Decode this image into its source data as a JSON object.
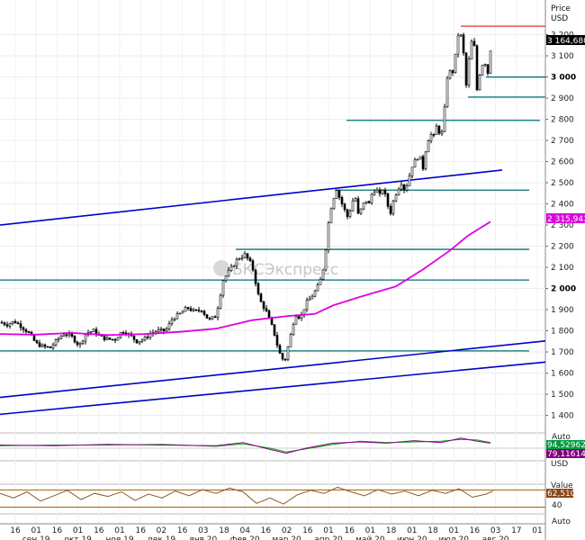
{
  "header": {
    "price_label": "Price",
    "currency_label": "USD"
  },
  "watermark": {
    "text": "БКСЭкспресс"
  },
  "last_price_tag": "3 164,6800",
  "ma_tag": "2 315,9438",
  "indicator1": {
    "scale_label": "Auto",
    "value_a": "94,529623",
    "value_b": "79,116144",
    "unit": "USD"
  },
  "indicator2": {
    "scale_label": "Value",
    "value": "62,510",
    "tick_40": "40",
    "auto_label": "Auto"
  },
  "x_ticks": [
    "16",
    "01",
    "16",
    "01",
    "16",
    "01",
    "16",
    "02",
    "16",
    "03",
    "18",
    "04",
    "16",
    "02",
    "16",
    "01",
    "16",
    "01",
    "18",
    "01",
    "18",
    "01",
    "16",
    "03",
    "17",
    "01"
  ],
  "x_month_labels": [
    "сен 19",
    "окт 19",
    "ноя 19",
    "дек 19",
    "янв 20",
    "фев 20",
    "мар 20",
    "апр 20",
    "май 20",
    "июн 20",
    "июл 20",
    "авг 20"
  ],
  "colors": {
    "candle": "#000000",
    "ma": "#e000e0",
    "channel": "#0000c8",
    "level": "#007070",
    "resistance": "#e03030",
    "macd_a": "#8b008b",
    "macd_b": "#00a000",
    "osc": "#8b5a2b",
    "osc_band": "#a06000",
    "tag_black": "#000000",
    "tag_ma": "#e000e0",
    "tag_green": "#009a3c",
    "tag_purple": "#800080",
    "tag_brown": "#8b4513"
  },
  "chart_data": {
    "type": "candlestick",
    "yunit": "USD",
    "ylim": [
      1330,
      3330
    ],
    "y_ticks": [
      1400,
      1500,
      1600,
      1700,
      1800,
      1900,
      2000,
      2100,
      2200,
      2300,
      2400,
      2500,
      2600,
      2700,
      2800,
      2900,
      3000,
      3100,
      3200
    ],
    "y_tick_labels": [
      "1 400",
      "1 500",
      "1 600",
      "1 700",
      "1 800",
      "1 900",
      "2 000",
      "2 100",
      "2 200",
      "2 300",
      "2 400",
      "2 500",
      "2 600",
      "2 700",
      "2 800",
      "2 900",
      "3 000",
      "3 100",
      "3 200"
    ],
    "close_path": [
      [
        0,
        1840
      ],
      [
        8,
        1830
      ],
      [
        16,
        1845
      ],
      [
        24,
        1820
      ],
      [
        32,
        1790
      ],
      [
        40,
        1740
      ],
      [
        48,
        1725
      ],
      [
        56,
        1720
      ],
      [
        64,
        1760
      ],
      [
        72,
        1790
      ],
      [
        80,
        1770
      ],
      [
        88,
        1730
      ],
      [
        96,
        1790
      ],
      [
        104,
        1800
      ],
      [
        112,
        1770
      ],
      [
        120,
        1760
      ],
      [
        128,
        1760
      ],
      [
        136,
        1800
      ],
      [
        144,
        1780
      ],
      [
        152,
        1750
      ],
      [
        160,
        1760
      ],
      [
        168,
        1790
      ],
      [
        176,
        1800
      ],
      [
        184,
        1800
      ],
      [
        192,
        1860
      ],
      [
        200,
        1880
      ],
      [
        208,
        1910
      ],
      [
        216,
        1890
      ],
      [
        224,
        1900
      ],
      [
        232,
        1850
      ],
      [
        240,
        1870
      ],
      [
        248,
        2040
      ],
      [
        256,
        2090
      ],
      [
        264,
        2140
      ],
      [
        272,
        2160
      ],
      [
        280,
        2110
      ],
      [
        288,
        1950
      ],
      [
        296,
        1890
      ],
      [
        304,
        1800
      ],
      [
        310,
        1700
      ],
      [
        316,
        1650
      ],
      [
        322,
        1760
      ],
      [
        328,
        1880
      ],
      [
        334,
        1860
      ],
      [
        340,
        1930
      ],
      [
        346,
        1960
      ],
      [
        352,
        2000
      ],
      [
        358,
        2060
      ],
      [
        362,
        2190
      ],
      [
        366,
        2350
      ],
      [
        370,
        2420
      ],
      [
        374,
        2470
      ],
      [
        378,
        2420
      ],
      [
        382,
        2380
      ],
      [
        386,
        2340
      ],
      [
        390,
        2380
      ],
      [
        394,
        2450
      ],
      [
        398,
        2350
      ],
      [
        402,
        2380
      ],
      [
        406,
        2420
      ],
      [
        410,
        2400
      ],
      [
        414,
        2460
      ],
      [
        418,
        2470
      ],
      [
        422,
        2440
      ],
      [
        426,
        2480
      ],
      [
        430,
        2400
      ],
      [
        434,
        2360
      ],
      [
        438,
        2430
      ],
      [
        442,
        2470
      ],
      [
        446,
        2500
      ],
      [
        450,
        2460
      ],
      [
        454,
        2520
      ],
      [
        458,
        2580
      ],
      [
        462,
        2610
      ],
      [
        466,
        2630
      ],
      [
        470,
        2570
      ],
      [
        474,
        2680
      ],
      [
        478,
        2730
      ],
      [
        482,
        2720
      ],
      [
        486,
        2780
      ],
      [
        490,
        2700
      ],
      [
        494,
        2850
      ],
      [
        498,
        3050
      ],
      [
        502,
        3000
      ],
      [
        506,
        3100
      ],
      [
        510,
        3230
      ],
      [
        514,
        3160
      ],
      [
        518,
        2960
      ],
      [
        522,
        3120
      ],
      [
        526,
        3210
      ],
      [
        530,
        2940
      ],
      [
        534,
        3040
      ],
      [
        538,
        3080
      ],
      [
        542,
        3020
      ],
      [
        546,
        3165
      ]
    ],
    "ma_path": [
      [
        0,
        1785
      ],
      [
        40,
        1782
      ],
      [
        80,
        1790
      ],
      [
        120,
        1780
      ],
      [
        160,
        1785
      ],
      [
        200,
        1795
      ],
      [
        240,
        1810
      ],
      [
        280,
        1850
      ],
      [
        320,
        1870
      ],
      [
        350,
        1880
      ],
      [
        370,
        1920
      ],
      [
        400,
        1960
      ],
      [
        440,
        2010
      ],
      [
        470,
        2090
      ],
      [
        500,
        2180
      ],
      [
        520,
        2250
      ],
      [
        545,
        2316
      ]
    ],
    "channel_lines": [
      {
        "x": [
          0,
          558
        ],
        "y": [
          2300,
          2560
        ]
      },
      {
        "x": [
          0,
          606
        ],
        "y": [
          1485,
          1752
        ]
      },
      {
        "x": [
          0,
          606
        ],
        "y": [
          1405,
          1652
        ]
      }
    ],
    "levels": [
      {
        "value": 3240,
        "x_from": 512,
        "x_to": 606,
        "kind": "resistance"
      },
      {
        "value": 3000,
        "x_from": 540,
        "x_to": 606,
        "kind": "support"
      },
      {
        "value": 2905,
        "x_from": 520,
        "x_to": 606,
        "kind": "support"
      },
      {
        "value": 2795,
        "x_from": 385,
        "x_to": 600,
        "kind": "support"
      },
      {
        "value": 2465,
        "x_from": 372,
        "x_to": 588,
        "kind": "support"
      },
      {
        "value": 2185,
        "x_from": 262,
        "x_to": 588,
        "kind": "support"
      },
      {
        "value": 2040,
        "x_from": 0,
        "x_to": 588,
        "kind": "support"
      },
      {
        "value": 1705,
        "x_from": 0,
        "x_to": 588,
        "kind": "support"
      }
    ],
    "macd_a_path": [
      [
        0,
        5
      ],
      [
        60,
        4
      ],
      [
        120,
        6
      ],
      [
        180,
        5
      ],
      [
        240,
        4
      ],
      [
        270,
        9
      ],
      [
        300,
        -2
      ],
      [
        318,
        -8
      ],
      [
        340,
        0
      ],
      [
        370,
        8
      ],
      [
        400,
        10
      ],
      [
        430,
        8
      ],
      [
        460,
        12
      ],
      [
        490,
        9
      ],
      [
        512,
        16
      ],
      [
        530,
        11
      ],
      [
        545,
        8
      ]
    ],
    "macd_b_path": [
      [
        0,
        4
      ],
      [
        60,
        5
      ],
      [
        120,
        5
      ],
      [
        180,
        6
      ],
      [
        240,
        3
      ],
      [
        270,
        7
      ],
      [
        300,
        0
      ],
      [
        318,
        -6
      ],
      [
        340,
        -1
      ],
      [
        370,
        6
      ],
      [
        400,
        11
      ],
      [
        430,
        9
      ],
      [
        460,
        10
      ],
      [
        490,
        11
      ],
      [
        512,
        14
      ],
      [
        530,
        13
      ],
      [
        545,
        9
      ]
    ],
    "osc_path": [
      [
        0,
        58
      ],
      [
        15,
        52
      ],
      [
        30,
        60
      ],
      [
        45,
        48
      ],
      [
        60,
        55
      ],
      [
        75,
        62
      ],
      [
        90,
        50
      ],
      [
        105,
        58
      ],
      [
        120,
        54
      ],
      [
        135,
        60
      ],
      [
        150,
        49
      ],
      [
        165,
        57
      ],
      [
        180,
        52
      ],
      [
        195,
        61
      ],
      [
        210,
        55
      ],
      [
        225,
        63
      ],
      [
        240,
        58
      ],
      [
        255,
        65
      ],
      [
        270,
        60
      ],
      [
        285,
        45
      ],
      [
        300,
        52
      ],
      [
        315,
        44
      ],
      [
        330,
        56
      ],
      [
        345,
        62
      ],
      [
        360,
        58
      ],
      [
        375,
        66
      ],
      [
        390,
        60
      ],
      [
        405,
        55
      ],
      [
        420,
        63
      ],
      [
        435,
        57
      ],
      [
        450,
        61
      ],
      [
        465,
        55
      ],
      [
        480,
        62
      ],
      [
        495,
        58
      ],
      [
        510,
        64
      ],
      [
        525,
        53
      ],
      [
        540,
        57
      ],
      [
        548,
        61
      ]
    ]
  }
}
